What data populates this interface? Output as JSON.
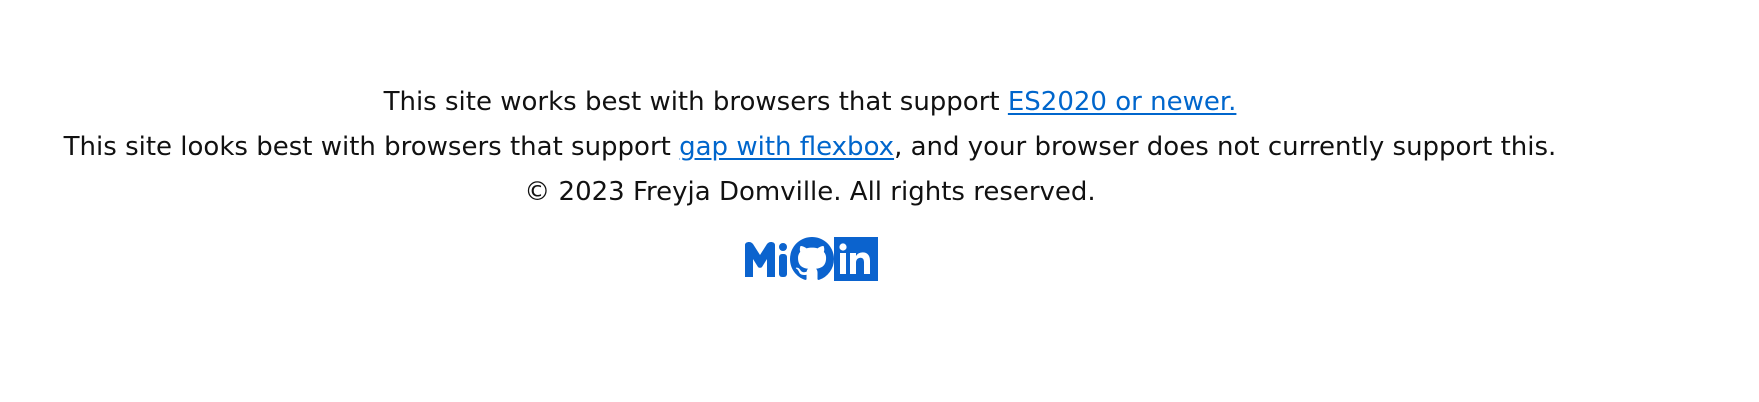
{
  "footer": {
    "es_notice": {
      "prefix": "This site works best with browsers that support ",
      "link_text": "ES2020 or newer."
    },
    "flex_notice": {
      "prefix": "This site looks best with browsers that support ",
      "link_text": "gap with flexbox",
      "suffix": ", and your browser does not currently support this."
    },
    "copyright": "© 2023 Freyja Domville. All rights reserved."
  },
  "socials": {
    "accent_color": "#0b63ce",
    "links": [
      {
        "icon": "misskey-icon",
        "text": "Mi"
      },
      {
        "icon": "github-icon"
      },
      {
        "icon": "linkedin-icon",
        "text": "in"
      }
    ]
  },
  "colors": {
    "link": "#0066cc",
    "text": "#111111",
    "background": "#ffffff"
  }
}
